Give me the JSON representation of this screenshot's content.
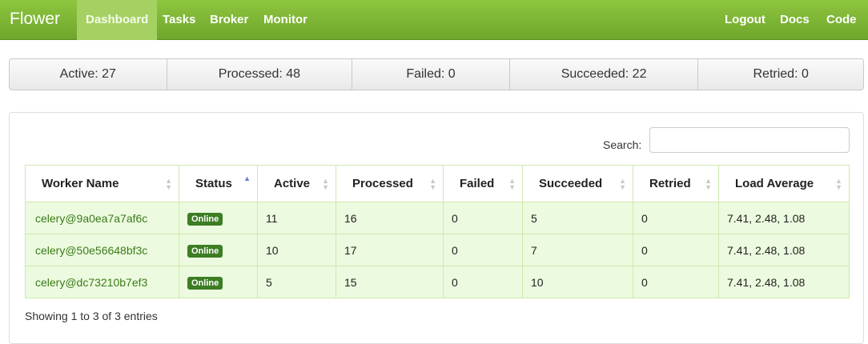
{
  "navbar": {
    "brand": "Flower",
    "items": [
      {
        "label": "Dashboard"
      },
      {
        "label": "Tasks"
      },
      {
        "label": "Broker"
      },
      {
        "label": "Monitor"
      }
    ],
    "right_items": [
      {
        "label": "Logout"
      },
      {
        "label": "Docs"
      },
      {
        "label": "Code"
      }
    ],
    "accent_color": "#8dc63f"
  },
  "stats": [
    {
      "label": "Active: 27"
    },
    {
      "label": "Processed: 48"
    },
    {
      "label": "Failed: 0"
    },
    {
      "label": "Succeeded: 22"
    },
    {
      "label": "Retried: 0"
    }
  ],
  "search": {
    "label": "Search:",
    "value": ""
  },
  "table": {
    "columns": [
      "Worker Name",
      "Status",
      "Active",
      "Processed",
      "Failed",
      "Succeeded",
      "Retried",
      "Load Average"
    ],
    "sorted_column": "Status",
    "rows": [
      {
        "name": "celery@9a0ea7a7af6c",
        "status": "Online",
        "active": "11",
        "processed": "16",
        "failed": "0",
        "succeeded": "5",
        "retried": "0",
        "load": "7.41, 2.48, 1.08"
      },
      {
        "name": "celery@50e56648bf3c",
        "status": "Online",
        "active": "10",
        "processed": "17",
        "failed": "0",
        "succeeded": "7",
        "retried": "0",
        "load": "7.41, 2.48, 1.08"
      },
      {
        "name": "celery@dc73210b7ef3",
        "status": "Online",
        "active": "5",
        "processed": "15",
        "failed": "0",
        "succeeded": "10",
        "retried": "0",
        "load": "7.41, 2.48, 1.08"
      }
    ],
    "info": "Showing 1 to 3 of 3 entries"
  }
}
